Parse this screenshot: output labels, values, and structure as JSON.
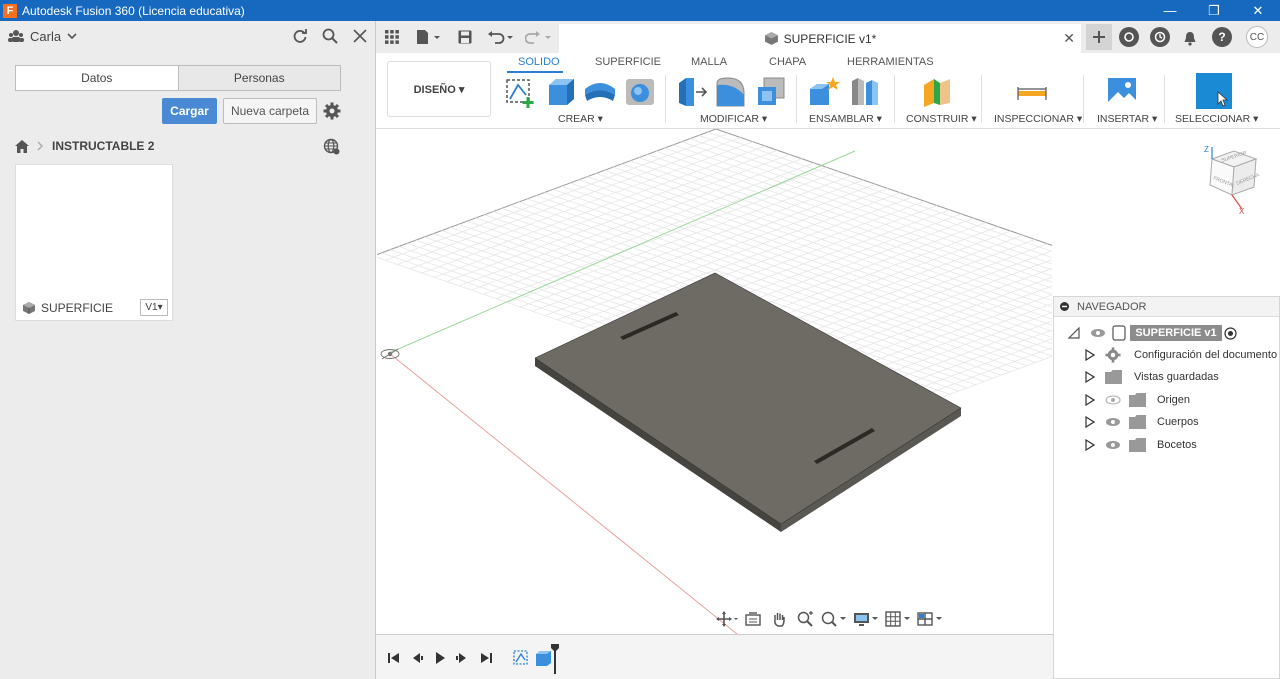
{
  "window": {
    "title": "Autodesk Fusion 360 (Licencia educativa)",
    "app_icon_letter": "F",
    "minimize": "—",
    "restore": "❐",
    "close": "✕"
  },
  "data_panel": {
    "user": "Carla",
    "tabs": [
      "Datos",
      "Personas"
    ],
    "upload_label": "Cargar",
    "new_folder_label": "Nueva carpeta",
    "breadcrumb": "INSTRUCTABLE 2",
    "file": {
      "name": "SUPERFICIE",
      "version": "V1▾"
    }
  },
  "doc_tab": {
    "title": "SUPERFICIE v1*",
    "close": "✕",
    "user_initials": "CC"
  },
  "ribbon": {
    "workspace": "DISEÑO ▾",
    "tabs": [
      "SOLIDO",
      "SUPERFICIE",
      "MALLA",
      "CHAPA",
      "HERRAMIENTAS"
    ],
    "groups": [
      "CREAR ▾",
      "MODIFICAR ▾",
      "ENSAMBLAR ▾",
      "CONSTRUIR ▾",
      "INSPECCIONAR ▾",
      "INSERTAR ▾",
      "SELECCIONAR ▾"
    ]
  },
  "navigator": {
    "title": "NAVEGADOR",
    "root": "SUPERFICIE v1",
    "items": [
      "Configuración del documento",
      "Vistas guardadas",
      "Origen",
      "Cuerpos",
      "Bocetos"
    ]
  },
  "viewcube": {
    "faces": [
      "SUPERIOR",
      "FRONTAL",
      "DERECHA"
    ],
    "axis_z": "Z",
    "axis_x": "X"
  },
  "colors": {
    "titlebar": "#1769c0",
    "accent": "#2c7fd4",
    "upload_button": "#4a8ad4",
    "body_top": "#6e6b64",
    "body_side": "#46443f",
    "select_tool": "#1a8ad4"
  }
}
